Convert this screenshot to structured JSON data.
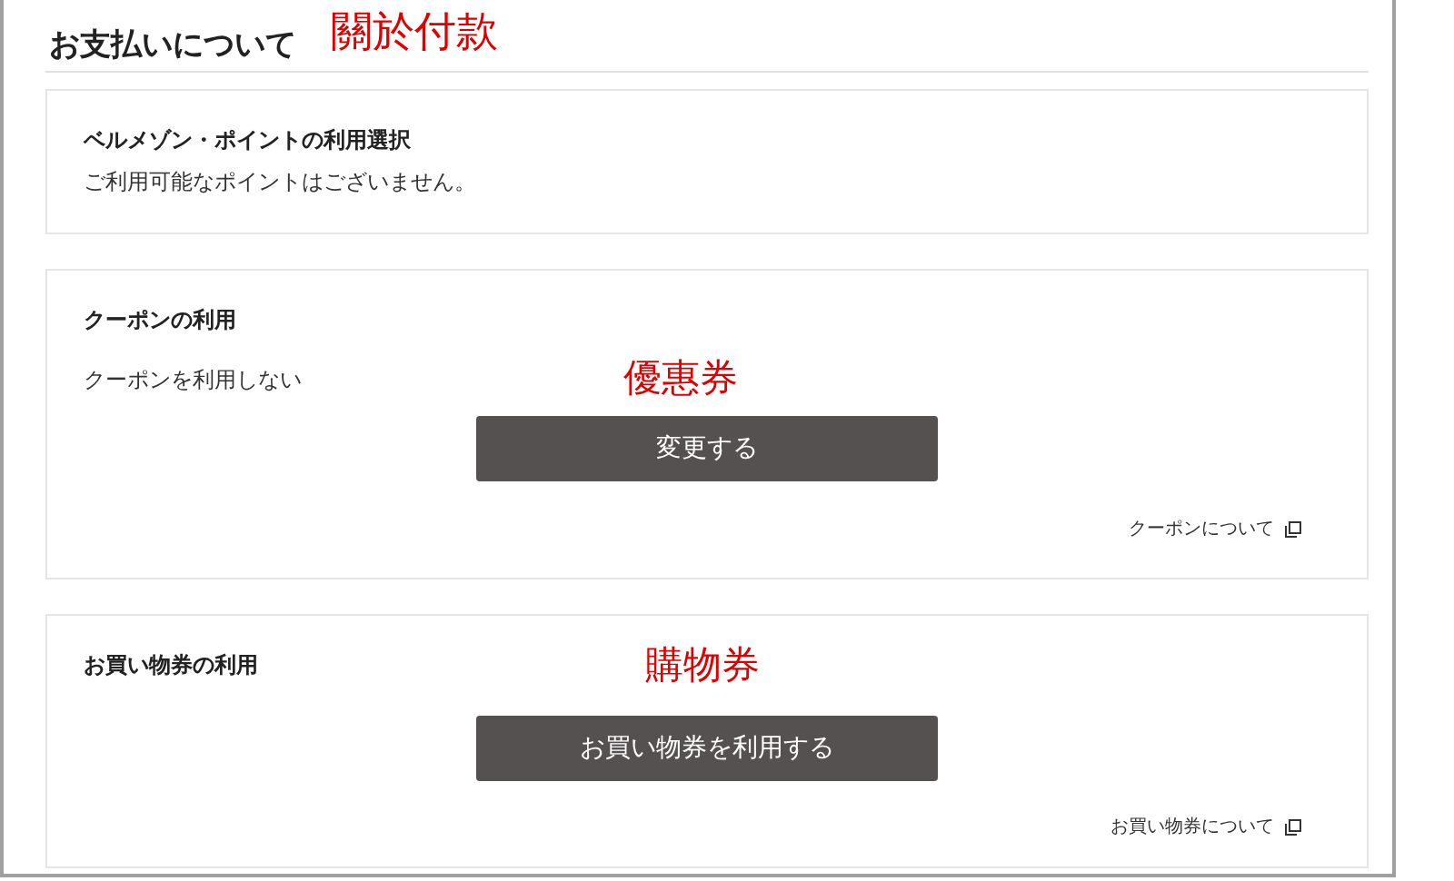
{
  "heading": "お支払いについて",
  "annotations": [
    "關於付款",
    "優惠券",
    "購物券"
  ],
  "points": {
    "title": "ベルメゾン・ポイントの利用選択",
    "message": "ご利用可能なポイントはございません。"
  },
  "coupon": {
    "title": "クーポンの利用",
    "status": "クーポンを利用しない",
    "button": "変更する",
    "link": "クーポンについて"
  },
  "gift": {
    "title": "お買い物券の利用",
    "button": "お買い物券を利用する",
    "link": "お買い物券について"
  }
}
